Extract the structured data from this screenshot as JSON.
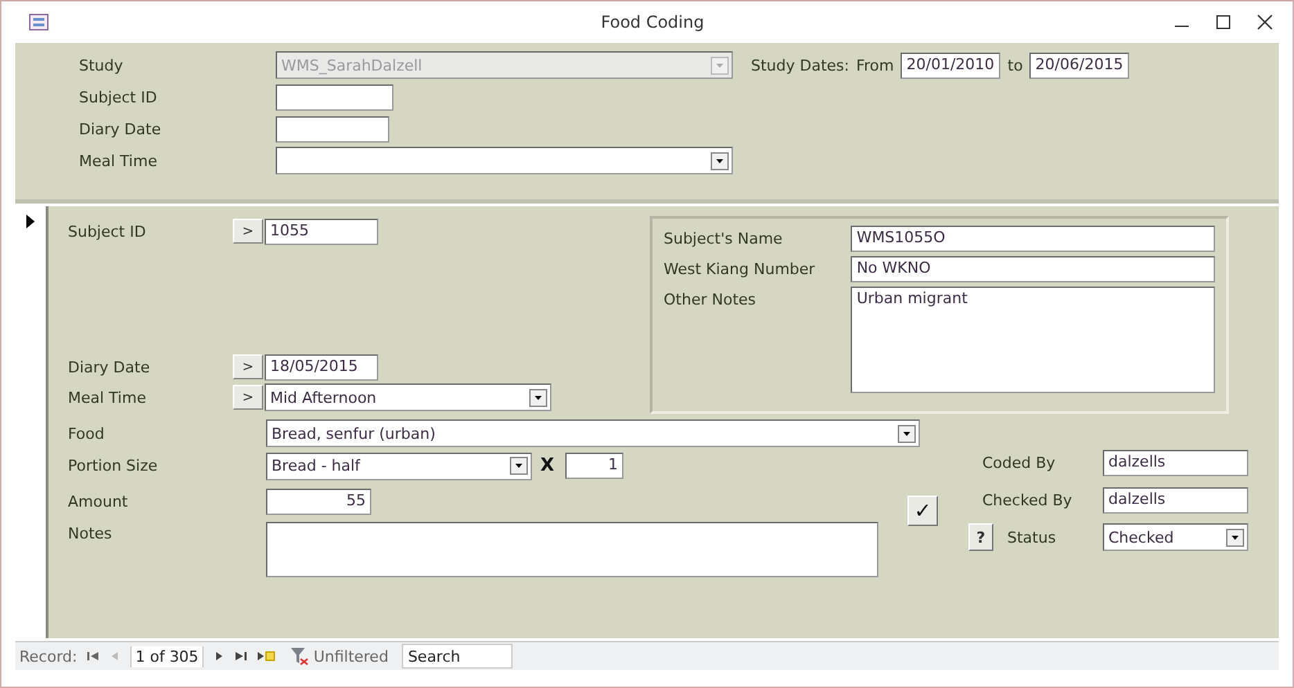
{
  "window": {
    "title": "Food Coding"
  },
  "header": {
    "study": {
      "label": "Study",
      "value": "WMS_SarahDalzell",
      "disabled": true
    },
    "study_dates": {
      "label": "Study Dates:",
      "from_label": "From",
      "from": "20/01/2010",
      "to_label": "to",
      "to": "20/06/2015"
    },
    "subject_id": {
      "label": "Subject ID"
    },
    "diary_date": {
      "label": "Diary Date"
    },
    "meal_time": {
      "label": "Meal Time"
    }
  },
  "detail": {
    "subject_id": {
      "label": "Subject ID",
      "button": ">",
      "value": "1055"
    },
    "subject_panel": [
      {
        "label": "Subject's Name",
        "value": "WMS1055O",
        "kind": "line"
      },
      {
        "label": "West Kiang Number",
        "value": "No WKNO",
        "kind": "line"
      },
      {
        "label": "Other Notes",
        "value": "Urban migrant",
        "kind": "memo"
      }
    ],
    "diary_date": {
      "label": "Diary Date",
      "button": ">",
      "value": "18/05/2015"
    },
    "meal_time": {
      "label": "Meal Time",
      "button": ">",
      "value": "Mid Afternoon"
    },
    "food": {
      "label": "Food",
      "value": "Bread, senfur (urban)"
    },
    "portion_size": {
      "label": "Portion Size",
      "value": "Bread - half",
      "times": "X",
      "multiplier": "1"
    },
    "amount": {
      "label": "Amount",
      "value": "55"
    },
    "notes": {
      "label": "Notes"
    },
    "check_button": "✓",
    "coded_by": {
      "label": "Coded By",
      "value": "dalzells"
    },
    "checked_by": {
      "label": "Checked By",
      "value": "dalzells"
    },
    "help_button": "?",
    "status": {
      "label": "Status",
      "value": "Checked"
    }
  },
  "navigation": {
    "label": "Record:",
    "position": "1 of 305",
    "filter": "Unfiltered",
    "search_placeholder": "Search"
  }
}
